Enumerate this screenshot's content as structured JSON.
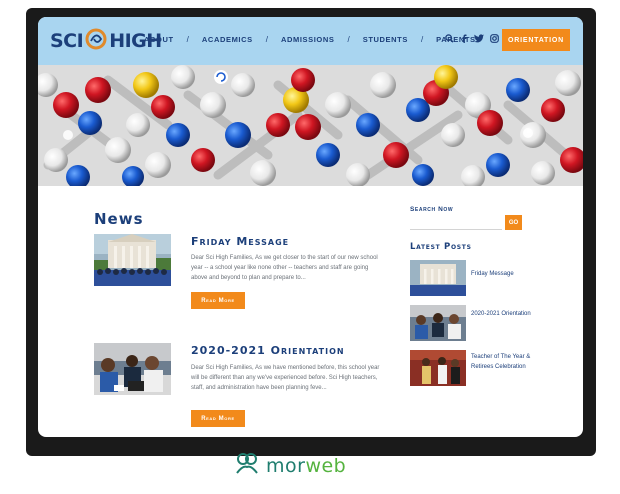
{
  "logo": {
    "part1": "SCI",
    "part2": "HIGH"
  },
  "nav": [
    {
      "label": "About"
    },
    {
      "label": "Academics"
    },
    {
      "label": "Admissions"
    },
    {
      "label": "Students"
    },
    {
      "label": "Parents"
    }
  ],
  "nav_separator": "/",
  "header": {
    "icons": [
      "search-icon",
      "facebook-icon",
      "twitter-icon",
      "instagram-icon"
    ],
    "cta_label": "Orientation"
  },
  "hero": {
    "icon": "loading-spinner-icon"
  },
  "news": {
    "heading": "News",
    "posts": [
      {
        "title": "Friday Message",
        "excerpt": "Dear Sci High Families, As we get closer to the start of our new school year -- a school year like none other -- teachers and staff are going above and beyond to plan and prepare to...",
        "read_more": "Read More"
      },
      {
        "title": "2020-2021 Orientation",
        "excerpt": "Dear Sci High Families, As we have mentioned before, this school year will be different than any we've experienced before. Sci High teachers, staff, and administration have been planning feve...",
        "read_more": "Read More"
      }
    ]
  },
  "sidebar": {
    "search_label": "Search Now",
    "search_placeholder": "",
    "go_label": "GO",
    "latest_heading": "Latest Posts",
    "latest": [
      {
        "label": "Friday Message"
      },
      {
        "label": "2020-2021 Orientation"
      },
      {
        "label": "Teacher of The Year & Retirees Celebration"
      }
    ]
  },
  "watermark": {
    "part1": "mor",
    "part2": "web"
  },
  "colors": {
    "header_bg": "#a9d5f0",
    "navy": "#1c3f7a",
    "accent_orange": "#f28a1b",
    "watermark_teal": "#1f7d6e",
    "watermark_green": "#55b33f"
  }
}
